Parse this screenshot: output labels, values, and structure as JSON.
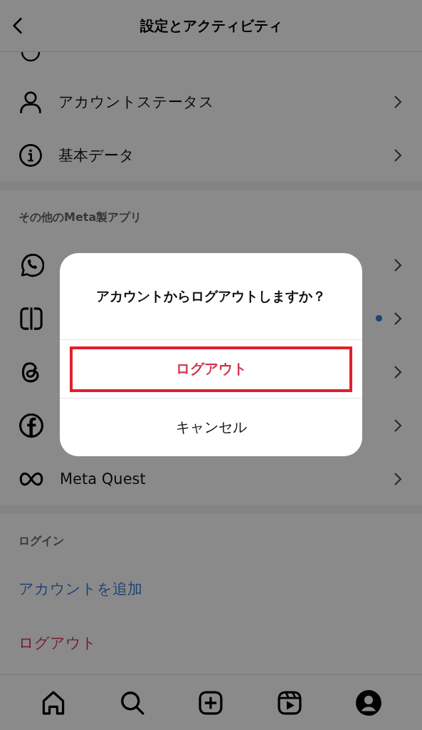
{
  "header": {
    "title": "設定とアクティビティ"
  },
  "account_rows": [
    {
      "label": "アカウントステータス"
    },
    {
      "label": "基本データ"
    }
  ],
  "apps_section": {
    "heading": "その他のMeta製アプリ",
    "rows": [
      {
        "dot": false
      },
      {
        "dot": true
      },
      {
        "dot": false
      },
      {
        "dot": false
      },
      {
        "label": "Meta Quest",
        "dot": false
      }
    ]
  },
  "login_section": {
    "heading": "ログイン",
    "links": [
      {
        "label": "アカウントを追加",
        "kind": "add"
      },
      {
        "label": "ログアウト",
        "kind": "logout"
      }
    ]
  },
  "tab_bar": [
    {
      "selected": false
    },
    {
      "selected": false
    },
    {
      "selected": false
    },
    {
      "selected": false
    },
    {
      "selected": true
    }
  ],
  "dialog": {
    "title": "アカウントからログアウトしますか？",
    "actions": [
      {
        "label": "ログアウト",
        "kind": "destructive",
        "highlighted": true
      },
      {
        "label": "キャンセル",
        "kind": "normal",
        "highlighted": false
      }
    ]
  }
}
